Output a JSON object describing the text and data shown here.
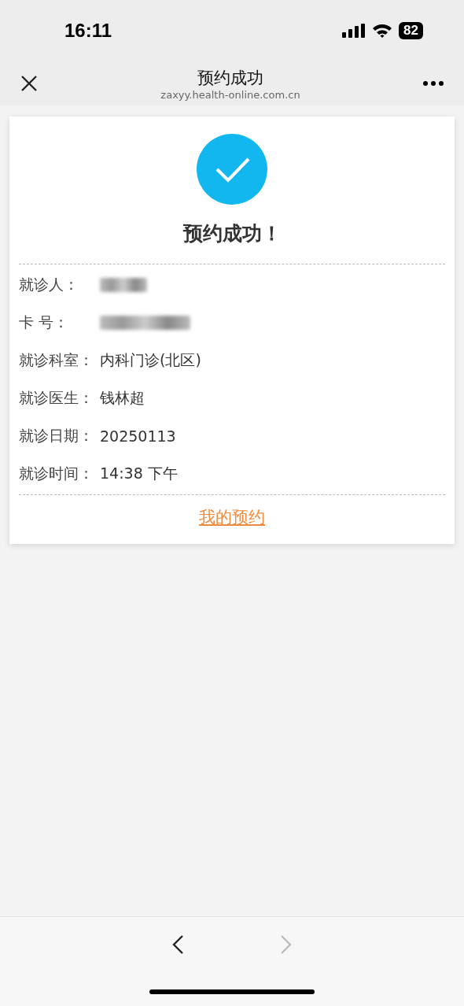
{
  "status_bar": {
    "time": "16:11",
    "battery": "82"
  },
  "nav": {
    "title": "预约成功",
    "subtitle": "zaxyy.health-online.com.cn"
  },
  "result": {
    "title": "预约成功！"
  },
  "fields": [
    {
      "label": "就诊人：",
      "kind": "redacted"
    },
    {
      "label": "卡 号：",
      "kind": "redacted"
    },
    {
      "label": "就诊科室：",
      "kind": "text",
      "value": "内科门诊(北区)"
    },
    {
      "label": "就诊医生：",
      "kind": "text",
      "value": "钱林超"
    },
    {
      "label": "就诊日期：",
      "kind": "text",
      "value": "20250113"
    },
    {
      "label": "就诊时间：",
      "kind": "text",
      "value": "14:38 下午"
    }
  ],
  "link": "我的预约",
  "browser_bar": {
    "back_disabled": false,
    "forward_disabled": true
  }
}
